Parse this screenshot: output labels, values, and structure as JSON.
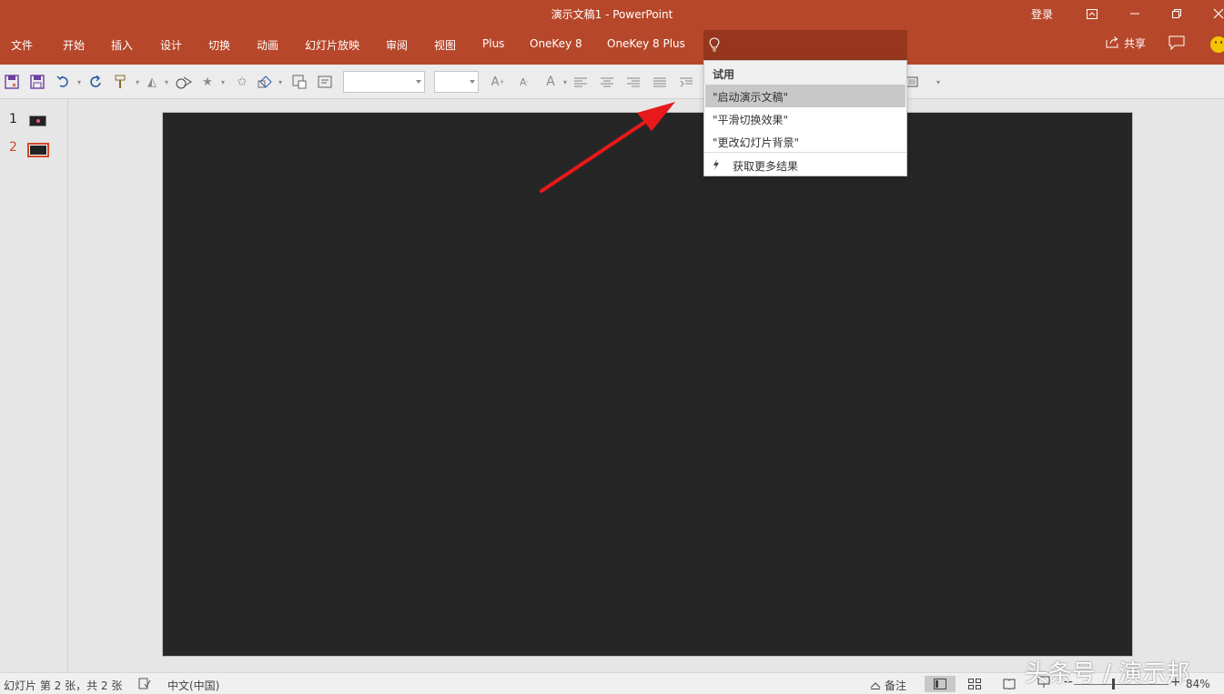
{
  "titlebar": {
    "title": "演示文稿1  -  PowerPoint",
    "login": "登录"
  },
  "menu": {
    "items": [
      "文件",
      "开始",
      "插入",
      "设计",
      "切换",
      "动画",
      "幻灯片放映",
      "审阅",
      "视图",
      "Plus",
      "OneKey 8",
      "OneKey 8 Plus"
    ],
    "share": "共享"
  },
  "slides": {
    "numbers": [
      "1",
      "2"
    ],
    "active_color": "#d24726"
  },
  "tell_me": {
    "header": "试用",
    "suggestions": [
      "\"启动演示文稿\"",
      "\"平滑切换效果\"",
      "\"更改幻灯片背景\""
    ],
    "more": "获取更多结果"
  },
  "statusbar": {
    "slide_info": "幻灯片 第 2 张，共 2 张",
    "language": "中文(中国)",
    "notes": "备注",
    "zoom": "84%"
  },
  "watermark": "头条号 / 演示邦",
  "colors": {
    "accent": "#b7472a",
    "tellme_bg": "#95361d",
    "slide_bg": "#262626",
    "arrow": "#e8191a"
  }
}
